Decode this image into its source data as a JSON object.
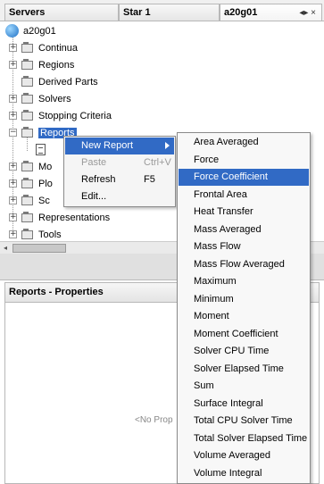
{
  "tabs": [
    {
      "label": "Servers"
    },
    {
      "label": "Star 1"
    },
    {
      "label": "a20g01",
      "controls": "◂▸ ×"
    }
  ],
  "tree": {
    "root": "a20g01",
    "items": [
      {
        "label": "Continua"
      },
      {
        "label": "Regions"
      },
      {
        "label": "Derived Parts"
      },
      {
        "label": "Solvers"
      },
      {
        "label": "Stopping Criteria"
      },
      {
        "label": "Reports"
      },
      {
        "label": "Mo"
      },
      {
        "label": "Plo"
      },
      {
        "label": "Sc"
      },
      {
        "label": "Representations"
      },
      {
        "label": "Tools"
      }
    ]
  },
  "context_menu": {
    "items": [
      {
        "label": "New Report",
        "shortcut": ""
      },
      {
        "label": "Paste",
        "shortcut": "Ctrl+V"
      },
      {
        "label": "Refresh",
        "shortcut": "F5"
      },
      {
        "label": "Edit...",
        "shortcut": ""
      }
    ]
  },
  "submenu": {
    "items": [
      {
        "label": "Area Averaged"
      },
      {
        "label": "Force"
      },
      {
        "label": "Force Coefficient"
      },
      {
        "label": "Frontal Area"
      },
      {
        "label": "Heat Transfer"
      },
      {
        "label": "Mass Averaged"
      },
      {
        "label": "Mass Flow"
      },
      {
        "label": "Mass Flow Averaged"
      },
      {
        "label": "Maximum"
      },
      {
        "label": "Minimum"
      },
      {
        "label": "Moment"
      },
      {
        "label": "Moment Coefficient"
      },
      {
        "label": "Solver CPU Time"
      },
      {
        "label": "Solver Elapsed Time"
      },
      {
        "label": "Sum"
      },
      {
        "label": "Surface Integral"
      },
      {
        "label": "Total CPU Solver Time"
      },
      {
        "label": "Total Solver Elapsed Time"
      },
      {
        "label": "Volume Averaged"
      },
      {
        "label": "Volume Integral"
      }
    ]
  },
  "properties": {
    "title": "Reports - Properties",
    "empty_text": "<No Prop"
  },
  "colors": {
    "selection": "#316ac5"
  }
}
